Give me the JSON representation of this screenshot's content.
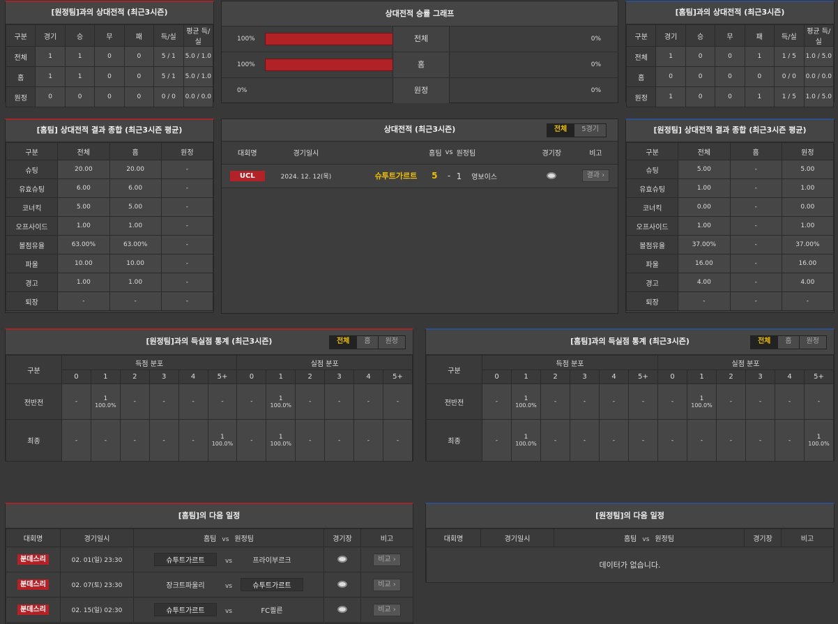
{
  "h2h_away": {
    "title": "[원정팀]과의 상대전적 (최근3시즌)",
    "headers": [
      "구분",
      "경기",
      "승",
      "무",
      "패",
      "득/실",
      "평균 득/실"
    ],
    "rows": [
      [
        "전체",
        "1",
        "1",
        "0",
        "0",
        "5 / 1",
        "5.0 / 1.0"
      ],
      [
        "홈",
        "1",
        "1",
        "0",
        "0",
        "5 / 1",
        "5.0 / 1.0"
      ],
      [
        "원정",
        "0",
        "0",
        "0",
        "0",
        "0 / 0",
        "0.0 / 0.0"
      ]
    ]
  },
  "winrate": {
    "title": "상대전적 승률 그래프",
    "rows": [
      {
        "left": "100%",
        "label": "전체",
        "right": "0%",
        "fill": 1.0
      },
      {
        "left": "100%",
        "label": "홈",
        "right": "0%",
        "fill": 1.0
      },
      {
        "left": "0%",
        "label": "원정",
        "right": "0%",
        "fill": 0.0
      }
    ]
  },
  "h2h_home": {
    "title": "[홈팀]과의 상대전적 (최근3시즌)",
    "headers": [
      "구분",
      "경기",
      "승",
      "무",
      "패",
      "득/실",
      "평균 득/실"
    ],
    "rows": [
      [
        "전체",
        "1",
        "0",
        "0",
        "1",
        "1 / 5",
        "1.0 / 5.0"
      ],
      [
        "홈",
        "0",
        "0",
        "0",
        "0",
        "0 / 0",
        "0.0 / 0.0"
      ],
      [
        "원정",
        "1",
        "0",
        "0",
        "1",
        "1 / 5",
        "1.0 / 5.0"
      ]
    ]
  },
  "home_summary": {
    "title": "[홈팀] 상대전적 결과 종합 (최근3시즌 평균)",
    "headers": [
      "구분",
      "전체",
      "홈",
      "원정"
    ],
    "rows": [
      [
        "슈팅",
        "20.00",
        "20.00",
        "-"
      ],
      [
        "유효슈팅",
        "6.00",
        "6.00",
        "-"
      ],
      [
        "코너킥",
        "5.00",
        "5.00",
        "-"
      ],
      [
        "오프사이드",
        "1.00",
        "1.00",
        "-"
      ],
      [
        "볼점유율",
        "63.00%",
        "63.00%",
        "-"
      ],
      [
        "파울",
        "10.00",
        "10.00",
        "-"
      ],
      [
        "경고",
        "1.00",
        "1.00",
        "-"
      ],
      [
        "퇴장",
        "-",
        "-",
        "-"
      ]
    ]
  },
  "h2h_matches": {
    "title": "상대전적 (최근3시즌)",
    "toggle": [
      "전체",
      "5경기"
    ],
    "headers": {
      "league": "대회명",
      "date": "경기일시",
      "home": "홈팀",
      "vs": "vs",
      "away": "원정팀",
      "venue": "경기장",
      "note": "비고"
    },
    "rows": [
      {
        "league": "UCL",
        "date": "2024. 12. 12(목)",
        "home": "슈투트가르트",
        "home_score": "5",
        "dash": "-",
        "away_score": "1",
        "away": "영보이스",
        "btn": "결과 ›"
      }
    ]
  },
  "away_summary": {
    "title": "[원정팀] 상대전적 결과 종합 (최근3시즌 평균)",
    "headers": [
      "구분",
      "전체",
      "홈",
      "원정"
    ],
    "rows": [
      [
        "슈팅",
        "5.00",
        "-",
        "5.00"
      ],
      [
        "유효슈팅",
        "1.00",
        "-",
        "1.00"
      ],
      [
        "코너킥",
        "0.00",
        "-",
        "0.00"
      ],
      [
        "오프사이드",
        "1.00",
        "-",
        "1.00"
      ],
      [
        "볼점유율",
        "37.00%",
        "-",
        "37.00%"
      ],
      [
        "파울",
        "16.00",
        "-",
        "16.00"
      ],
      [
        "경고",
        "4.00",
        "-",
        "4.00"
      ],
      [
        "퇴장",
        "-",
        "-",
        "-"
      ]
    ]
  },
  "goals_away": {
    "title": "[원정팀]과의 득실점 통계 (최근3시즌)",
    "toggle": [
      "전체",
      "홈",
      "원정"
    ],
    "col_label": "구분",
    "group_scored": "득점 분포",
    "group_conceded": "실점 분포",
    "buckets": [
      "0",
      "1",
      "2",
      "3",
      "4",
      "5+"
    ],
    "rows": [
      {
        "label": "전반전",
        "cells": [
          [
            "-"
          ],
          [
            "1",
            "100.0%"
          ],
          [
            "-"
          ],
          [
            "-"
          ],
          [
            "-"
          ],
          [
            "-"
          ],
          [
            "-"
          ],
          [
            "1",
            "100.0%"
          ],
          [
            "-"
          ],
          [
            "-"
          ],
          [
            "-"
          ],
          [
            "-"
          ]
        ]
      },
      {
        "label": "최종",
        "cells": [
          [
            "-"
          ],
          [
            "-"
          ],
          [
            "-"
          ],
          [
            "-"
          ],
          [
            "-"
          ],
          [
            "1",
            "100.0%"
          ],
          [
            "-"
          ],
          [
            "1",
            "100.0%"
          ],
          [
            "-"
          ],
          [
            "-"
          ],
          [
            "-"
          ],
          [
            "-"
          ]
        ]
      }
    ]
  },
  "goals_home": {
    "title": "[홈팀]과의 득실점 통계 (최근3시즌)",
    "toggle": [
      "전체",
      "홈",
      "원정"
    ],
    "col_label": "구분",
    "group_scored": "득점 분포",
    "group_conceded": "실점 분포",
    "buckets": [
      "0",
      "1",
      "2",
      "3",
      "4",
      "5+"
    ],
    "rows": [
      {
        "label": "전반전",
        "cells": [
          [
            "-"
          ],
          [
            "1",
            "100.0%"
          ],
          [
            "-"
          ],
          [
            "-"
          ],
          [
            "-"
          ],
          [
            "-"
          ],
          [
            "-"
          ],
          [
            "1",
            "100.0%"
          ],
          [
            "-"
          ],
          [
            "-"
          ],
          [
            "-"
          ],
          [
            "-"
          ]
        ]
      },
      {
        "label": "최종",
        "cells": [
          [
            "-"
          ],
          [
            "1",
            "100.0%"
          ],
          [
            "-"
          ],
          [
            "-"
          ],
          [
            "-"
          ],
          [
            "-"
          ],
          [
            "-"
          ],
          [
            "-"
          ],
          [
            "-"
          ],
          [
            "-"
          ],
          [
            "-"
          ],
          [
            "1",
            "100.0%"
          ]
        ]
      }
    ]
  },
  "home_next": {
    "title": "[홈팀]의 다음 일정",
    "headers": {
      "league": "대회명",
      "date": "경기일시",
      "home": "홈팀",
      "vs": "vs",
      "away": "원정팀",
      "venue": "경기장",
      "note": "비고"
    },
    "rows": [
      {
        "league": "분데스리",
        "date": "02. 01(일) 23:30",
        "home": "슈투트가르트",
        "home_box": true,
        "vs": "vs",
        "away": "프라이부르크",
        "away_box": false,
        "btn": "비교 ›"
      },
      {
        "league": "분데스리",
        "date": "02. 07(토) 23:30",
        "home": "장크트파울리",
        "home_box": false,
        "vs": "vs",
        "away": "슈투트가르트",
        "away_box": true,
        "btn": "비교 ›"
      },
      {
        "league": "분데스리",
        "date": "02. 15(일) 02:30",
        "home": "슈투트가르트",
        "home_box": true,
        "vs": "vs",
        "away": "FC쾰른",
        "away_box": false,
        "btn": "비교 ›"
      }
    ]
  },
  "away_next": {
    "title": "[원정팀]의 다음 일정",
    "headers": {
      "league": "대회명",
      "date": "경기일시",
      "home": "홈팀",
      "vs": "vs",
      "away": "원정팀",
      "venue": "경기장",
      "note": "비고"
    },
    "empty": "데이터가 없습니다."
  }
}
